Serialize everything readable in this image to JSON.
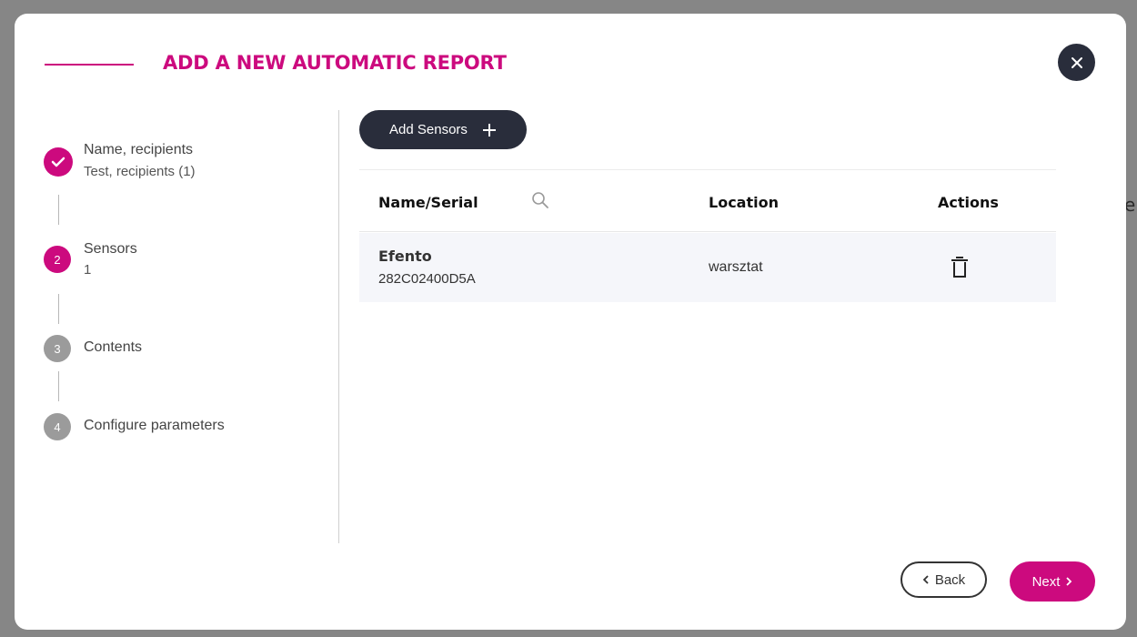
{
  "dialog": {
    "title": "ADD A NEW AUTOMATIC REPORT",
    "close_icon": "close-icon"
  },
  "steps": [
    {
      "number": "",
      "title": "Name, recipients",
      "subtitle": "Test, recipients (1)",
      "state": "done"
    },
    {
      "number": "2",
      "title": "Sensors",
      "subtitle": "1",
      "state": "active"
    },
    {
      "number": "3",
      "title": "Contents",
      "subtitle": "",
      "state": "inactive"
    },
    {
      "number": "4",
      "title": "Configure parameters",
      "subtitle": "",
      "state": "inactive"
    }
  ],
  "toolbar": {
    "add_sensors_label": "Add Sensors",
    "add_icon": "plus-icon"
  },
  "table": {
    "columns": [
      "Name/Serial",
      "Location",
      "Actions"
    ],
    "rows": [
      {
        "name": "Efento",
        "serial": "282C02400D5A",
        "location": "warsztat",
        "action_icon": "trash-icon"
      }
    ]
  },
  "footer": {
    "back_label": "Back",
    "next_label": "Next"
  },
  "colors": {
    "accent": "#cc0a7e",
    "dark": "#292d3b",
    "inactive_step": "#9b9b9b"
  }
}
